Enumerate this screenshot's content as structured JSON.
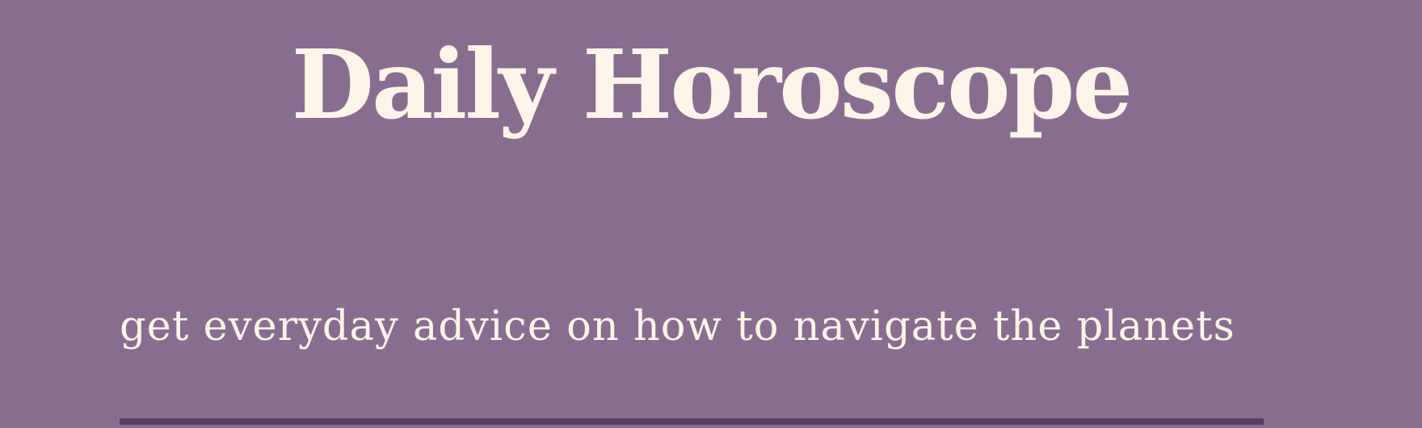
{
  "header": {
    "title": "Daily Horoscope",
    "subtitle": "get everyday advice on how to navigate the planets"
  },
  "colors": {
    "background": "#886d91",
    "text": "#fdf5e9",
    "divider": "#5a3d66"
  }
}
